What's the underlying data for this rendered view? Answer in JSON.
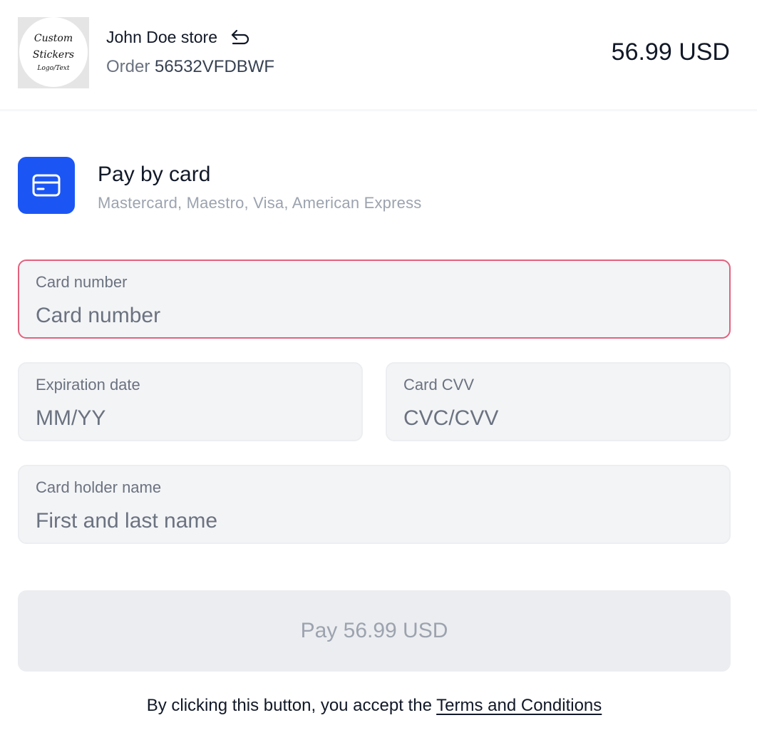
{
  "header": {
    "logo": {
      "line1": "Custom",
      "line2": "Stickers",
      "line3": "Logo/Text",
      "background": "#e5e5e5"
    },
    "store_name": "John Doe store",
    "back_icon": "return-arrow-icon",
    "order_label": "Order",
    "order_id": "56532VFDBWF",
    "total": "56.99 USD"
  },
  "payment_method": {
    "icon": "credit-card-icon",
    "icon_color": "#1b56f5",
    "title": "Pay by card",
    "subtitle": "Mastercard, Maestro, Visa, American Express"
  },
  "form": {
    "card_number": {
      "label": "Card number",
      "placeholder": "Card number",
      "value": "",
      "state": "error",
      "border_color": "#e2617e"
    },
    "expiration": {
      "label": "Expiration date",
      "placeholder": "MM/YY",
      "value": ""
    },
    "cvv": {
      "label": "Card CVV",
      "placeholder": "CVC/CVV",
      "value": ""
    },
    "holder": {
      "label": "Card holder name",
      "placeholder": "First and last name",
      "value": ""
    }
  },
  "pay_button": {
    "label": "Pay 56.99 USD",
    "disabled": true
  },
  "terms": {
    "text": "By clicking this button, you accept the",
    "link": "Terms and Conditions"
  }
}
